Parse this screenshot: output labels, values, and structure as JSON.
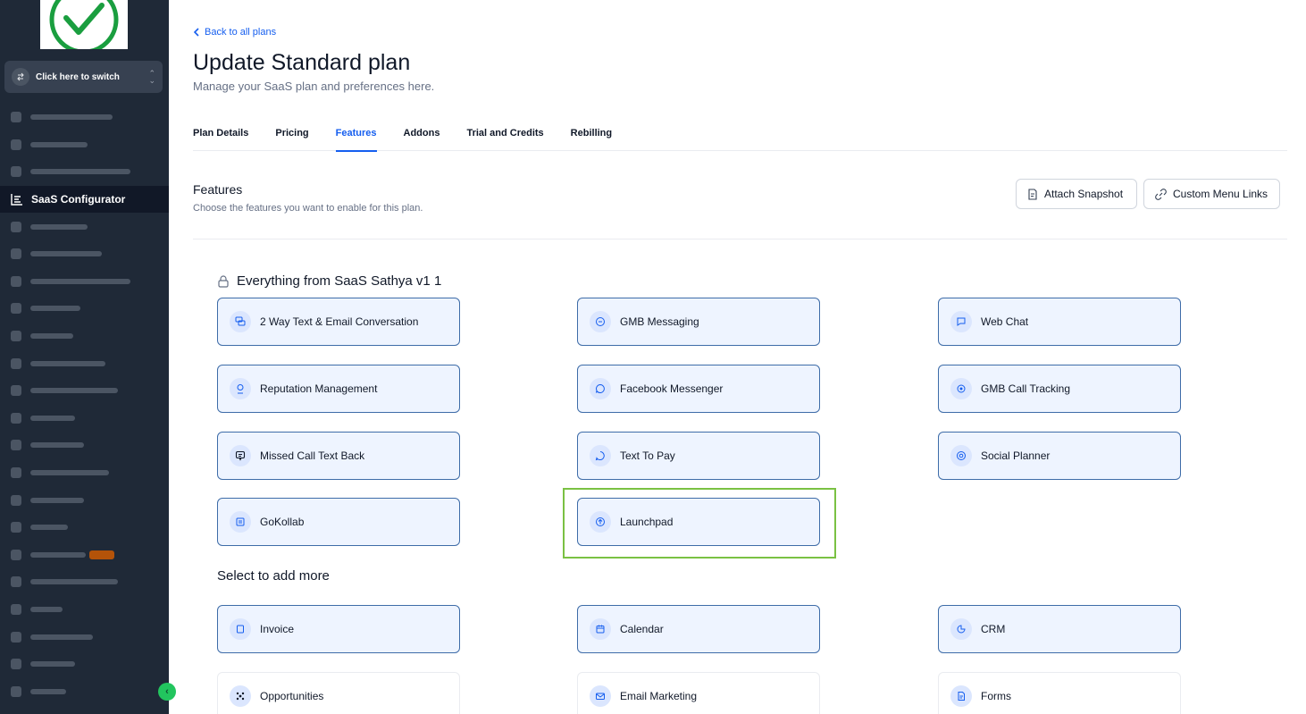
{
  "sidebar": {
    "switcher_label": "Click here to switch",
    "active_item_label": "SaaS Configurator",
    "blurred_item_widths": [
      92,
      64,
      112,
      null,
      64,
      80,
      112,
      56,
      48,
      84,
      98,
      50,
      60,
      88,
      60,
      42,
      28,
      98,
      36,
      70,
      50,
      40
    ]
  },
  "header": {
    "back_label": "Back to all plans",
    "title": "Update Standard plan",
    "subtitle": "Manage your SaaS plan and preferences here."
  },
  "tabs": [
    {
      "label": "Plan Details",
      "active": false
    },
    {
      "label": "Pricing",
      "active": false
    },
    {
      "label": "Features",
      "active": true
    },
    {
      "label": "Addons",
      "active": false
    },
    {
      "label": "Trial and Credits",
      "active": false
    },
    {
      "label": "Rebilling",
      "active": false
    }
  ],
  "features_section": {
    "title": "Features",
    "subtitle": "Choose the features you want to enable for this plan.",
    "attach_snapshot_label": "Attach Snapshot",
    "custom_menu_links_label": "Custom Menu Links"
  },
  "included_group": {
    "title": "Everything from SaaS Sathya v1 1",
    "items": [
      {
        "label": "2 Way Text & Email Conversation",
        "icon": "chat-bubbles-icon"
      },
      {
        "label": "GMB Messaging",
        "icon": "message-icon"
      },
      {
        "label": "Web Chat",
        "icon": "web-chat-icon"
      },
      {
        "label": "Reputation Management",
        "icon": "award-icon"
      },
      {
        "label": "Facebook Messenger",
        "icon": "messenger-icon"
      },
      {
        "label": "GMB Call Tracking",
        "icon": "target-icon"
      },
      {
        "label": "Missed Call Text Back",
        "icon": "sms-icon"
      },
      {
        "label": "Text To Pay",
        "icon": "payment-chat-icon"
      },
      {
        "label": "Social Planner",
        "icon": "social-icon"
      },
      {
        "label": "GoKollab",
        "icon": "community-icon"
      },
      {
        "label": "Launchpad",
        "icon": "rocket-icon"
      }
    ]
  },
  "more_group": {
    "title": "Select to add more",
    "items": [
      {
        "label": "Invoice",
        "icon": "invoice-icon",
        "selected": true
      },
      {
        "label": "Calendar",
        "icon": "calendar-icon",
        "selected": true
      },
      {
        "label": "CRM",
        "icon": "crm-icon",
        "selected": true
      },
      {
        "label": "Opportunities",
        "icon": "opportunities-icon",
        "selected": false
      },
      {
        "label": "Email Marketing",
        "icon": "email-icon",
        "selected": false
      },
      {
        "label": "Forms",
        "icon": "forms-icon",
        "selected": false
      }
    ]
  },
  "colors": {
    "accent": "#155eef",
    "card_border": "#3e6ca8",
    "card_bg": "#eef4ff",
    "highlight": "#7ac143",
    "sidebar_bg": "#1f2937"
  }
}
